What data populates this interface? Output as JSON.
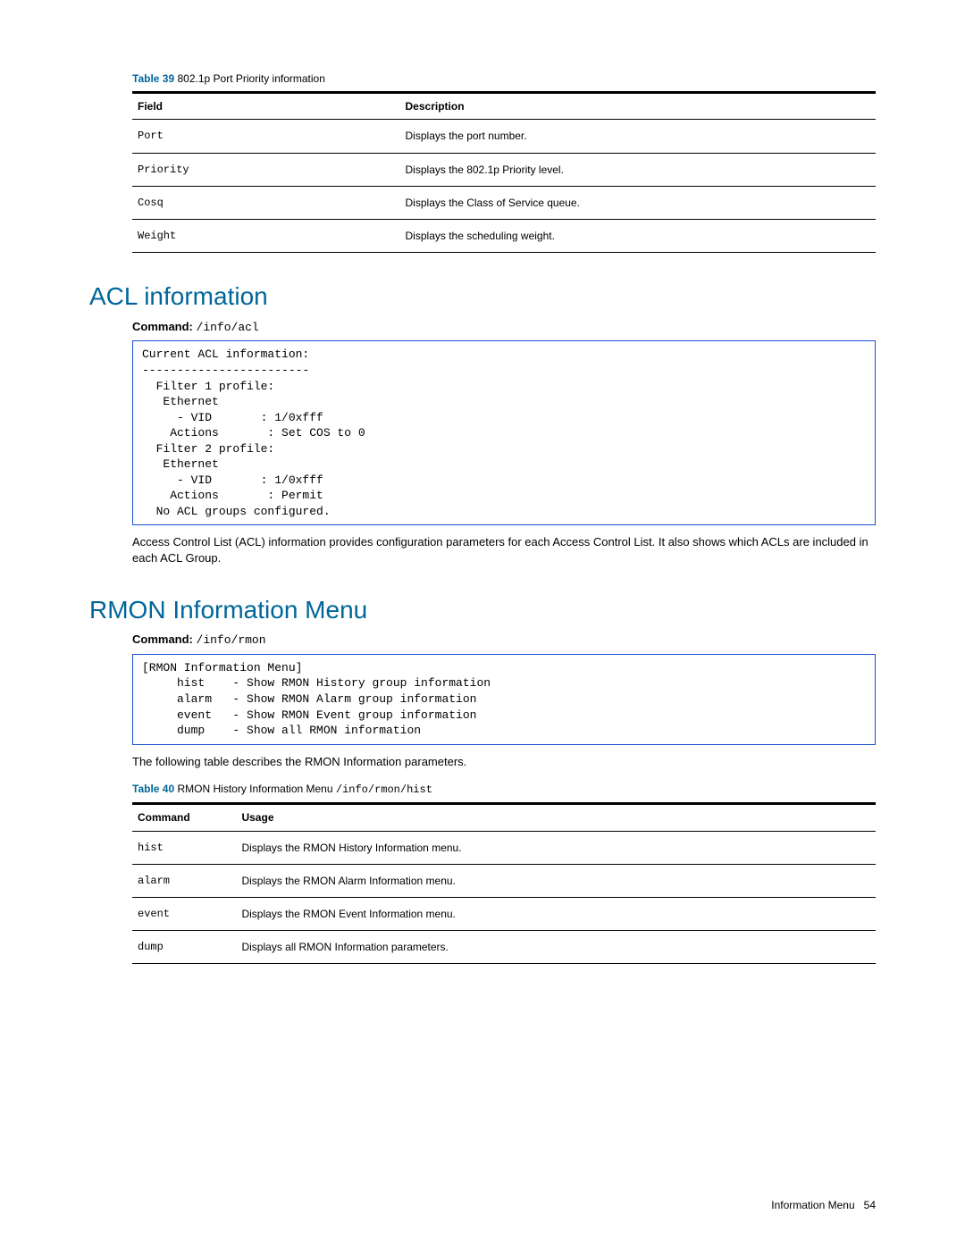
{
  "table39": {
    "caption_label": "Table 39",
    "caption_text": "802.1p Port Priority information",
    "headers": {
      "field": "Field",
      "desc": "Description"
    },
    "rows": [
      {
        "field": "Port",
        "desc": "Displays the port number."
      },
      {
        "field": "Priority",
        "desc": "Displays the 802.1p Priority level."
      },
      {
        "field": "Cosq",
        "desc": "Displays the Class of Service queue."
      },
      {
        "field": "Weight",
        "desc": "Displays the scheduling weight."
      }
    ]
  },
  "acl": {
    "heading": "ACL information",
    "command_label": "Command:",
    "command_value": "/info/acl",
    "output": "Current ACL information:\n------------------------\n  Filter 1 profile:\n   Ethernet\n     - VID       : 1/0xfff\n    Actions       : Set COS to 0\n  Filter 2 profile:\n   Ethernet\n     - VID       : 1/0xfff\n    Actions       : Permit\n  No ACL groups configured.",
    "para": "Access Control List (ACL) information provides configuration parameters for each Access Control List. It also shows which ACLs are included in each ACL Group."
  },
  "rmon": {
    "heading": "RMON Information Menu",
    "command_label": "Command:",
    "command_value": "/info/rmon",
    "output": "[RMON Information Menu]\n     hist    - Show RMON History group information\n     alarm   - Show RMON Alarm group information\n     event   - Show RMON Event group information\n     dump    - Show all RMON information",
    "para": "The following table describes the RMON Information parameters."
  },
  "table40": {
    "caption_label": "Table 40",
    "caption_text": "RMON History Information Menu",
    "caption_code": "/info/rmon/hist",
    "headers": {
      "cmd": "Command",
      "usage": "Usage"
    },
    "rows": [
      {
        "cmd": "hist",
        "usage": "Displays the RMON History Information menu."
      },
      {
        "cmd": "alarm",
        "usage": "Displays the RMON Alarm Information menu."
      },
      {
        "cmd": "event",
        "usage": "Displays the RMON Event Information menu."
      },
      {
        "cmd": "dump",
        "usage": "Displays all RMON Information parameters."
      }
    ]
  },
  "footer": {
    "section": "Information Menu",
    "page": "54"
  }
}
